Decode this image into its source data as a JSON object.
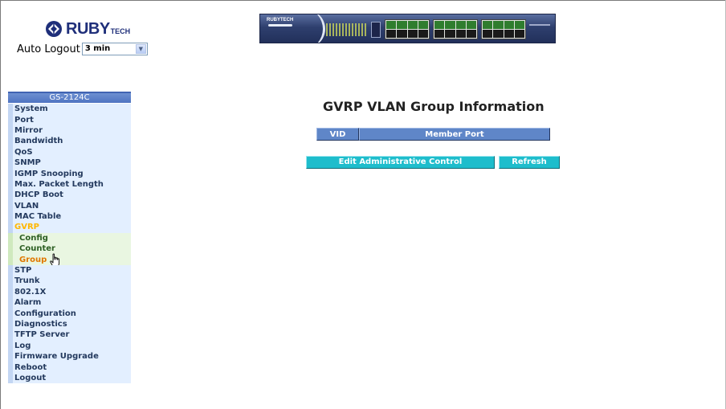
{
  "brand": {
    "name": "RUBY",
    "suffix": "TECH"
  },
  "auto_logout": {
    "label": "Auto Logout",
    "selected": "3 min"
  },
  "device": {
    "label": "RUBYTECH"
  },
  "sidebar": {
    "header": "GS-2124C",
    "items": [
      {
        "label": "System"
      },
      {
        "label": "Port"
      },
      {
        "label": "Mirror"
      },
      {
        "label": "Bandwidth"
      },
      {
        "label": "QoS"
      },
      {
        "label": "SNMP"
      },
      {
        "label": "IGMP Snooping"
      },
      {
        "label": "Max. Packet Length"
      },
      {
        "label": "DHCP Boot"
      },
      {
        "label": "VLAN"
      },
      {
        "label": "MAC Table"
      },
      {
        "label": "GVRP"
      }
    ],
    "sub_items": [
      {
        "label": "Config"
      },
      {
        "label": "Counter"
      },
      {
        "label": "Group"
      }
    ],
    "items_after": [
      {
        "label": "STP"
      },
      {
        "label": "Trunk"
      },
      {
        "label": "802.1X"
      },
      {
        "label": "Alarm"
      },
      {
        "label": "Configuration"
      },
      {
        "label": "Diagnostics"
      },
      {
        "label": "TFTP Server"
      },
      {
        "label": "Log"
      },
      {
        "label": "Firmware Upgrade"
      },
      {
        "label": "Reboot"
      },
      {
        "label": "Logout"
      }
    ]
  },
  "main": {
    "title": "GVRP VLAN Group Information",
    "columns": [
      "VID",
      "Member Port"
    ],
    "buttons": {
      "edit": "Edit Administrative Control",
      "refresh": "Refresh"
    }
  },
  "colors": {
    "header_blue": "#5f86c8",
    "button_cyan": "#1ebdcc",
    "nav_bg": "#e3efff",
    "sub_bg": "#e9f6e1",
    "active_nav": "#ffb700",
    "current_sub": "#e07800"
  }
}
